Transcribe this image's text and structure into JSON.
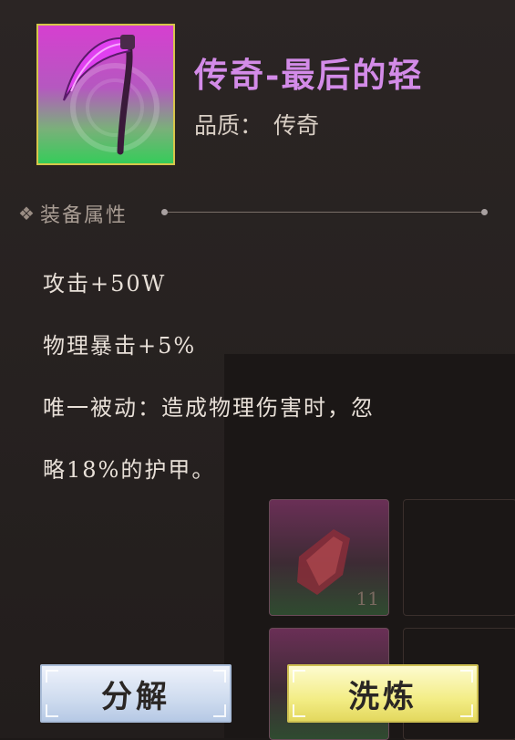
{
  "item": {
    "icon": "scythe-icon",
    "title": "传奇-最后的轻",
    "quality_label": "品质：",
    "quality_value": "传奇"
  },
  "section": {
    "title": "装备属性"
  },
  "attributes": [
    "攻击+50W",
    "物理暴击+5%",
    "唯一被动：造成物理伤害时，忽",
    "略18%的护甲。"
  ],
  "inventory": {
    "first_count": "11"
  },
  "buttons": {
    "decompose": "分解",
    "refine": "洗炼"
  },
  "colors": {
    "title": "#d38be8",
    "legendary_top": "#d63fd0",
    "legendary_bottom": "#36cc5a",
    "decompose_button": "#cfdcef",
    "refine_button": "#f3ed86"
  }
}
